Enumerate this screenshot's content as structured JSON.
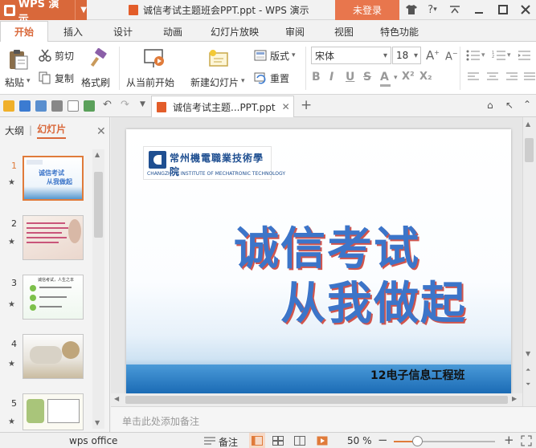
{
  "titlebar": {
    "app_name": "WPS 演示",
    "document_title": "诚信考试主题班会PPT.ppt - WPS 演示",
    "login_label": "未登录",
    "help_label": "?"
  },
  "menu": {
    "tabs": [
      "开始",
      "插入",
      "设计",
      "动画",
      "幻灯片放映",
      "审阅",
      "视图",
      "特色功能"
    ],
    "active": "开始"
  },
  "ribbon": {
    "paste_label": "粘贴",
    "cut_label": "剪切",
    "copy_label": "复制",
    "format_painter_label": "格式刷",
    "from_current_label": "从当前开始",
    "new_slide_label": "新建幻灯片",
    "layout_label": "版式",
    "reset_label": "重置",
    "font_name": "宋体",
    "font_size": "18",
    "bold_label": "B",
    "italic_label": "I",
    "underline_label": "U",
    "strike_label": "S",
    "font_color_label": "A",
    "superscript_label": "X²",
    "subscript_label": "X₂"
  },
  "quick_access": {
    "doc_tab_title": "诚信考试主题...PPT.ppt",
    "new_tab_label": "+"
  },
  "left_panel": {
    "outline_tab": "大纲",
    "slides_tab": "幻灯片",
    "slides": [
      {
        "number": "1"
      },
      {
        "number": "2"
      },
      {
        "number": "3"
      },
      {
        "number": "4"
      },
      {
        "number": "5"
      }
    ],
    "slide1_thumb_text": [
      "诚信考试",
      "从我做起"
    ],
    "slide3_thumb_text": [
      "诚信考试，人生之本"
    ]
  },
  "slide": {
    "logo_cn": "常州機電職業技術學院",
    "logo_en": "CHANGZHOU INSTITUTE OF MECHATRONIC TECHNOLOGY",
    "title_line1": "诚信考试",
    "title_line2": "从我做起",
    "class_name": "12电子信息工程班"
  },
  "notes": {
    "placeholder": "单击此处添加备注"
  },
  "statusbar": {
    "app_label": "wps office",
    "notes_label": "备注",
    "zoom_value": "50 %",
    "zoom_level": 0.5,
    "minus_label": "−",
    "plus_label": "+"
  },
  "colors": {
    "accent": "#d9683a",
    "wordart_fill": "#3c75c9",
    "wordart_shadow": "#d1554d"
  }
}
